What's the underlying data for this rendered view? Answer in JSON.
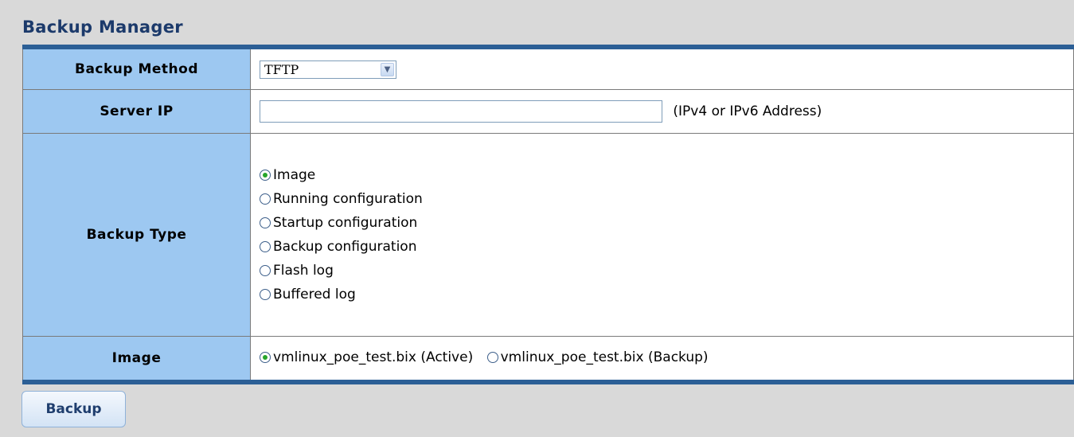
{
  "page": {
    "title": "Backup Manager"
  },
  "form": {
    "method": {
      "label": "Backup Method",
      "value": "TFTP"
    },
    "server": {
      "label": "Server IP",
      "value": "",
      "hint": "(IPv4 or IPv6 Address)"
    },
    "type": {
      "label": "Backup Type",
      "selected": "Image",
      "options": [
        {
          "label": "Image",
          "checked": true
        },
        {
          "label": "Running configuration",
          "checked": false
        },
        {
          "label": "Startup configuration",
          "checked": false
        },
        {
          "label": "Backup configuration",
          "checked": false
        },
        {
          "label": "Flash log",
          "checked": false
        },
        {
          "label": "Buffered log",
          "checked": false
        }
      ]
    },
    "image": {
      "label": "Image",
      "options": [
        {
          "label": "vmlinux_poe_test.bix (Active)",
          "checked": true
        },
        {
          "label": "vmlinux_poe_test.bix (Backup)",
          "checked": false
        }
      ]
    }
  },
  "actions": {
    "backup_label": "Backup"
  }
}
